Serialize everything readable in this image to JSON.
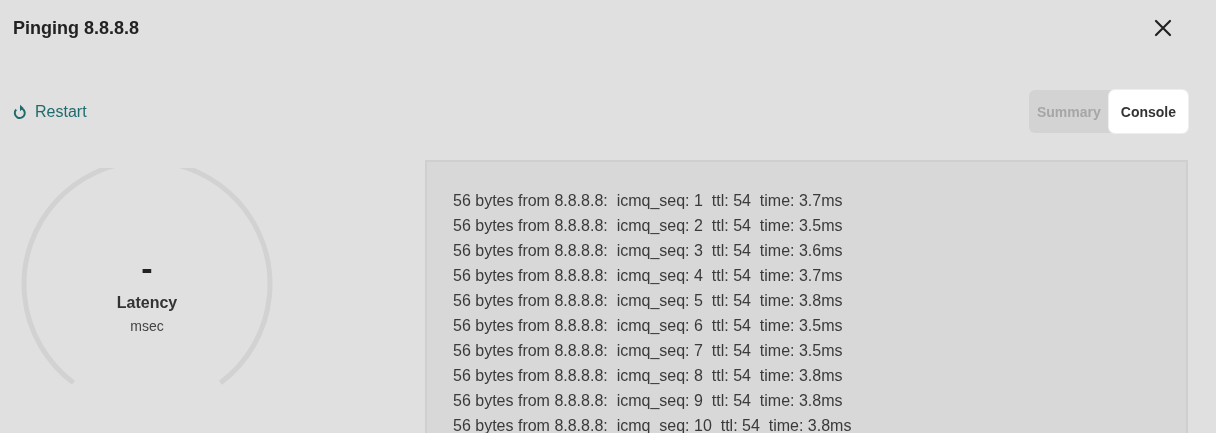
{
  "window": {
    "title": "Pinging 8.8.8.8"
  },
  "restart": {
    "label": "Restart"
  },
  "tabs": [
    {
      "label": "Summary",
      "selected": false
    },
    {
      "label": "Console",
      "selected": true
    }
  ],
  "gauge": {
    "value": "-",
    "label": "Latency",
    "unit": "msec"
  },
  "console": {
    "lines": [
      "56 bytes from 8.8.8.8:  icmq_seq: 1  ttl: 54  time: 3.7ms",
      "56 bytes from 8.8.8.8:  icmq_seq: 2  ttl: 54  time: 3.5ms",
      "56 bytes from 8.8.8.8:  icmq_seq: 3  ttl: 54  time: 3.6ms",
      "56 bytes from 8.8.8.8:  icmq_seq: 4  ttl: 54  time: 3.7ms",
      "56 bytes from 8.8.8.8:  icmq_seq: 5  ttl: 54  time: 3.8ms",
      "56 bytes from 8.8.8.8:  icmq_seq: 6  ttl: 54  time: 3.5ms",
      "56 bytes from 8.8.8.8:  icmq_seq: 7  ttl: 54  time: 3.5ms",
      "56 bytes from 8.8.8.8:  icmq_seq: 8  ttl: 54  time: 3.8ms",
      "56 bytes from 8.8.8.8:  icmq_seq: 9  ttl: 54  time: 3.8ms",
      "56 bytes from 8.8.8.8:  icmq_seq: 10  ttl: 54  time: 3.8ms"
    ]
  }
}
